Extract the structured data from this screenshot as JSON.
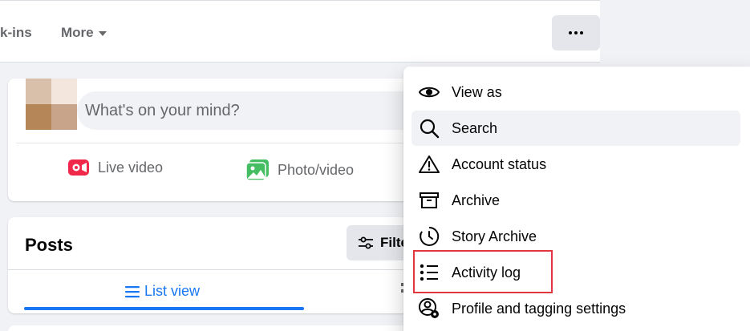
{
  "nav": {
    "partial_tab": "k-ins",
    "more_label": "More"
  },
  "composer": {
    "placeholder": "What's on your mind?",
    "live_label": "Live video",
    "photo_label": "Photo/video"
  },
  "posts": {
    "title": "Posts",
    "filter_label": "Filters",
    "list_view_label": "List view"
  },
  "menu": {
    "items": [
      {
        "label": "View as",
        "icon": "eye-icon"
      },
      {
        "label": "Search",
        "icon": "search-icon"
      },
      {
        "label": "Account status",
        "icon": "warning-icon"
      },
      {
        "label": "Archive",
        "icon": "archive-icon"
      },
      {
        "label": "Story Archive",
        "icon": "clock-history-icon"
      },
      {
        "label": "Activity log",
        "icon": "list-icon"
      },
      {
        "label": "Profile and tagging settings",
        "icon": "profile-settings-icon"
      }
    ]
  },
  "colors": {
    "accent": "#1877f2",
    "highlight": "#e0383e",
    "live": "#f02849",
    "photo": "#45bd62"
  }
}
